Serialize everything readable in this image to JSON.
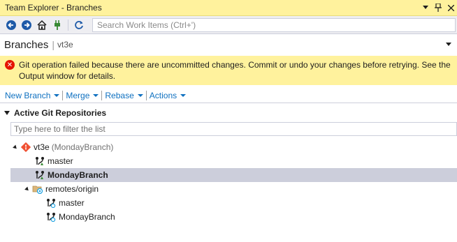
{
  "window": {
    "title": "Team Explorer - Branches",
    "pin_icon": "pin-icon",
    "close_icon": "close-icon"
  },
  "toolbar": {
    "back_icon": "back-arrow-icon",
    "forward_icon": "forward-arrow-icon",
    "home_icon": "home-icon",
    "connect_icon": "plug-icon",
    "refresh_icon": "refresh-icon",
    "search_placeholder": "Search Work Items (Ctrl+')"
  },
  "header": {
    "page_title": "Branches",
    "repo_name": "vt3e"
  },
  "error": {
    "icon": "error-icon",
    "message": "Git operation failed because there are uncommitted changes. Commit or undo your changes before retrying. See the Output window for details."
  },
  "actions": [
    {
      "label": "New Branch"
    },
    {
      "label": "Merge"
    },
    {
      "label": "Rebase"
    },
    {
      "label": "Actions"
    }
  ],
  "section": {
    "title": "Active Git Repositories",
    "filter_placeholder": "Type here to filter the list"
  },
  "tree": {
    "repo": {
      "name": "vt3e",
      "branch_note": "(MondayBranch)"
    },
    "local_branches": [
      {
        "name": "master",
        "selected": false
      },
      {
        "name": "MondayBranch",
        "selected": true
      }
    ],
    "remote": {
      "name": "remotes/origin"
    },
    "remote_branches": [
      {
        "name": "master"
      },
      {
        "name": "MondayBranch"
      }
    ]
  },
  "colors": {
    "titlebar_bg": "#fff29d",
    "link": "#0e70c0",
    "selection": "#cccedb",
    "error_red": "#e51400",
    "git_orange": "#f05133",
    "branch_green": "#388a34",
    "remote_blue": "#1ba1e2"
  }
}
